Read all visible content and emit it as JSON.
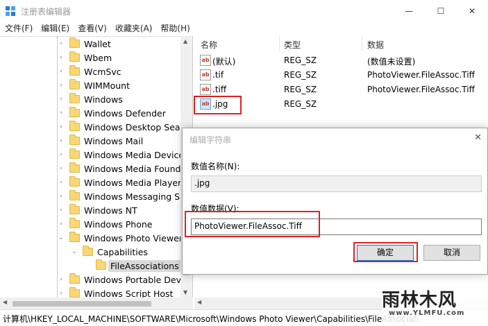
{
  "window": {
    "title": "注册表编辑器",
    "minimize_glyph": "—",
    "maximize_glyph": "☐",
    "close_glyph": "✕"
  },
  "menu": [
    "文件(F)",
    "编辑(E)",
    "查看(V)",
    "收藏夹(A)",
    "帮助(H)"
  ],
  "tree": {
    "items": [
      {
        "label": "Wallet",
        "expanded": false
      },
      {
        "label": "Wbem",
        "expanded": false
      },
      {
        "label": "WcmSvc",
        "expanded": false
      },
      {
        "label": "WIMMount",
        "expanded": false
      },
      {
        "label": "Windows",
        "expanded": false
      },
      {
        "label": "Windows Defender",
        "expanded": false
      },
      {
        "label": "Windows Desktop Sear",
        "expanded": false
      },
      {
        "label": "Windows Mail",
        "expanded": false
      },
      {
        "label": "Windows Media Device",
        "expanded": false
      },
      {
        "label": "Windows Media Founda",
        "expanded": false
      },
      {
        "label": "Windows Media Player",
        "expanded": false
      },
      {
        "label": "Windows Messaging Su",
        "expanded": false
      },
      {
        "label": "Windows NT",
        "expanded": false
      },
      {
        "label": "Windows Phone",
        "expanded": false
      },
      {
        "label": "Windows Photo Viewer",
        "expanded": true
      },
      {
        "label": "Capabilities",
        "expanded": true
      },
      {
        "label": "FileAssociations",
        "selected": true
      },
      {
        "label": "Windows Portable Devic",
        "expanded": false
      },
      {
        "label": "Windows Script Host",
        "expanded": false
      }
    ]
  },
  "list": {
    "columns": [
      "名称",
      "类型",
      "数据"
    ],
    "rows": [
      {
        "name": "(默认)",
        "type": "REG_SZ",
        "data": "(数值未设置)"
      },
      {
        "name": ".tif",
        "type": "REG_SZ",
        "data": "PhotoViewer.FileAssoc.Tiff"
      },
      {
        "name": ".tiff",
        "type": "REG_SZ",
        "data": "PhotoViewer.FileAssoc.Tiff"
      },
      {
        "name": ".jpg",
        "type": "REG_SZ",
        "data": ""
      }
    ],
    "icon_text": "ab"
  },
  "dialog": {
    "title": "编辑字符串",
    "close_glyph": "✕",
    "name_label": "数值名称(N):",
    "name_value": ".jpg",
    "data_label": "数值数据(V):",
    "data_value": "PhotoViewer.FileAssoc.Tiff",
    "ok_label": "确定",
    "cancel_label": "取消"
  },
  "status": {
    "path": "计算机\\HKEY_LOCAL_MACHINE\\SOFTWARE\\Microsoft\\Windows Photo Viewer\\Capabilities\\FileAssociations"
  },
  "watermark": {
    "main": "雨林木风",
    "sub": "www.YLMFU.com"
  },
  "colors": {
    "highlight_red": "#e02020",
    "folder_yellow": "#f8d775",
    "selection_blue": "#cce8ff"
  }
}
